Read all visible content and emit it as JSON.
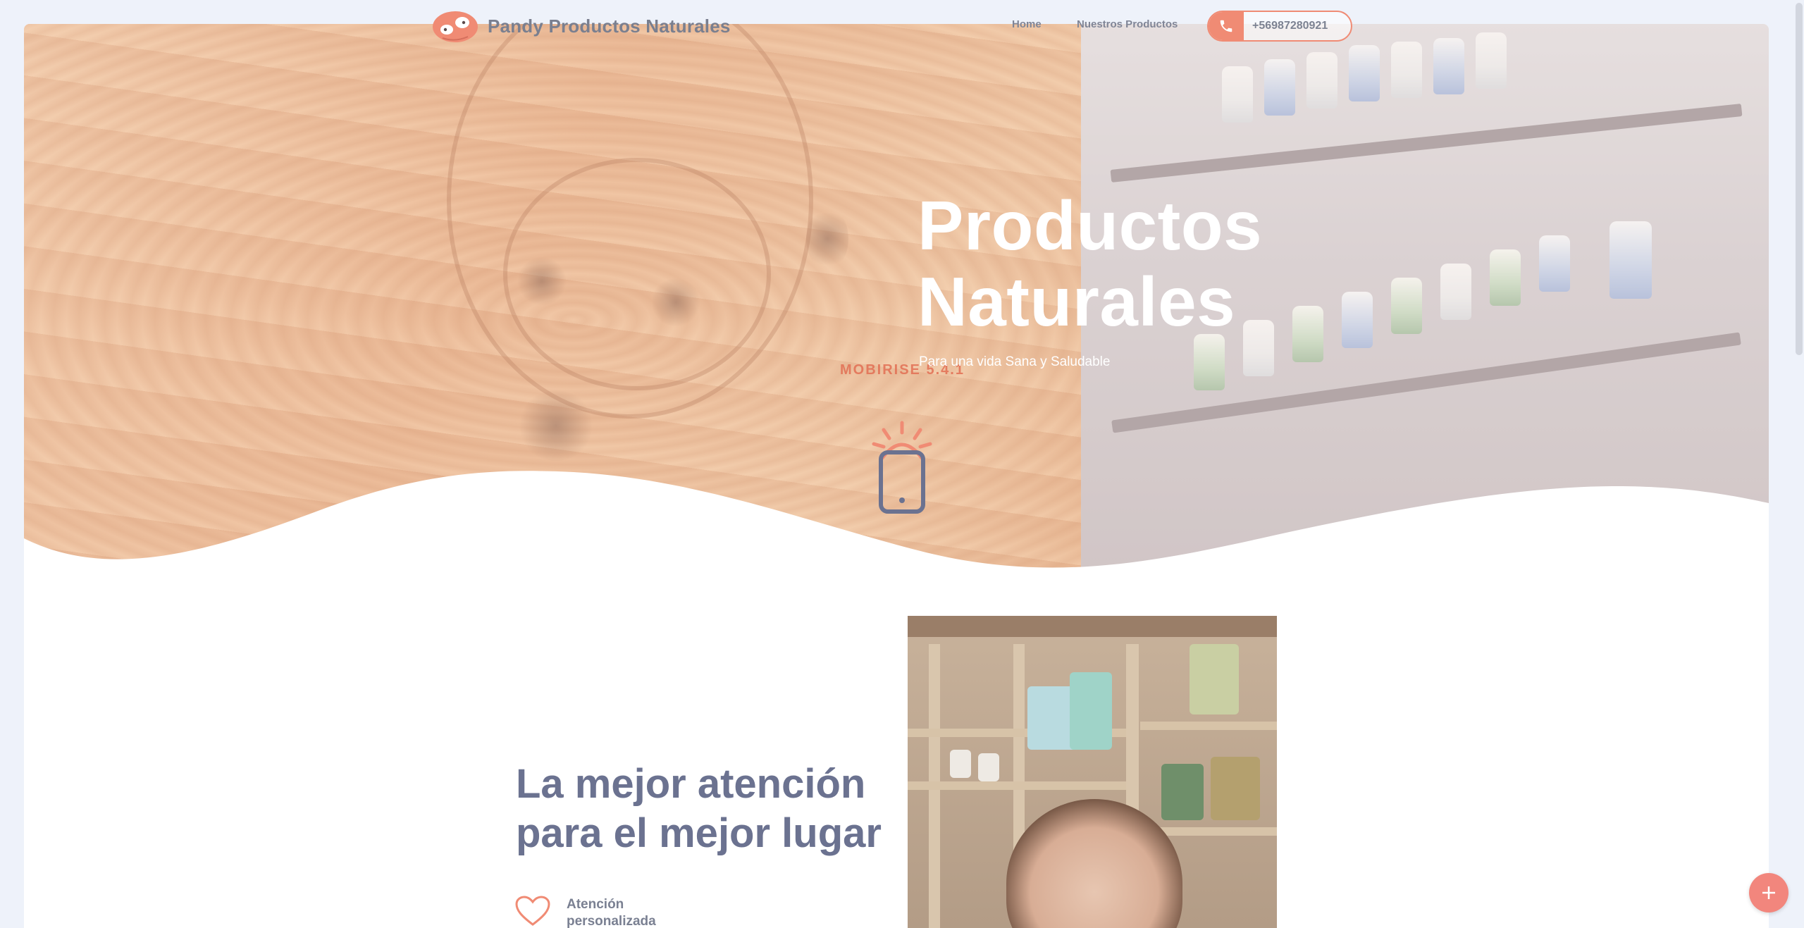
{
  "header": {
    "brand": "Pandy Productos Naturales",
    "nav": [
      {
        "label": "Home"
      },
      {
        "label": "Nuestros Productos"
      }
    ],
    "phone": "+56987280921"
  },
  "hero": {
    "title_line1": "Productos",
    "title_line2": "Naturales",
    "subtitle": "Para una vida Sana y Saludable",
    "badge": "MOBIRISE 5.4.1"
  },
  "section2": {
    "title_line1": "La mejor atención",
    "title_line2": "para el mejor lugar",
    "feature_label": "Atención personalizada"
  },
  "colors": {
    "accent": "#f08b74",
    "heading": "#6b7290",
    "text": "#7a8092",
    "background": "#eef2fa"
  },
  "icons": {
    "phone": "phone-icon",
    "bulb": "light-bulb-icon",
    "heart": "heart-icon",
    "fab": "plus-icon"
  }
}
